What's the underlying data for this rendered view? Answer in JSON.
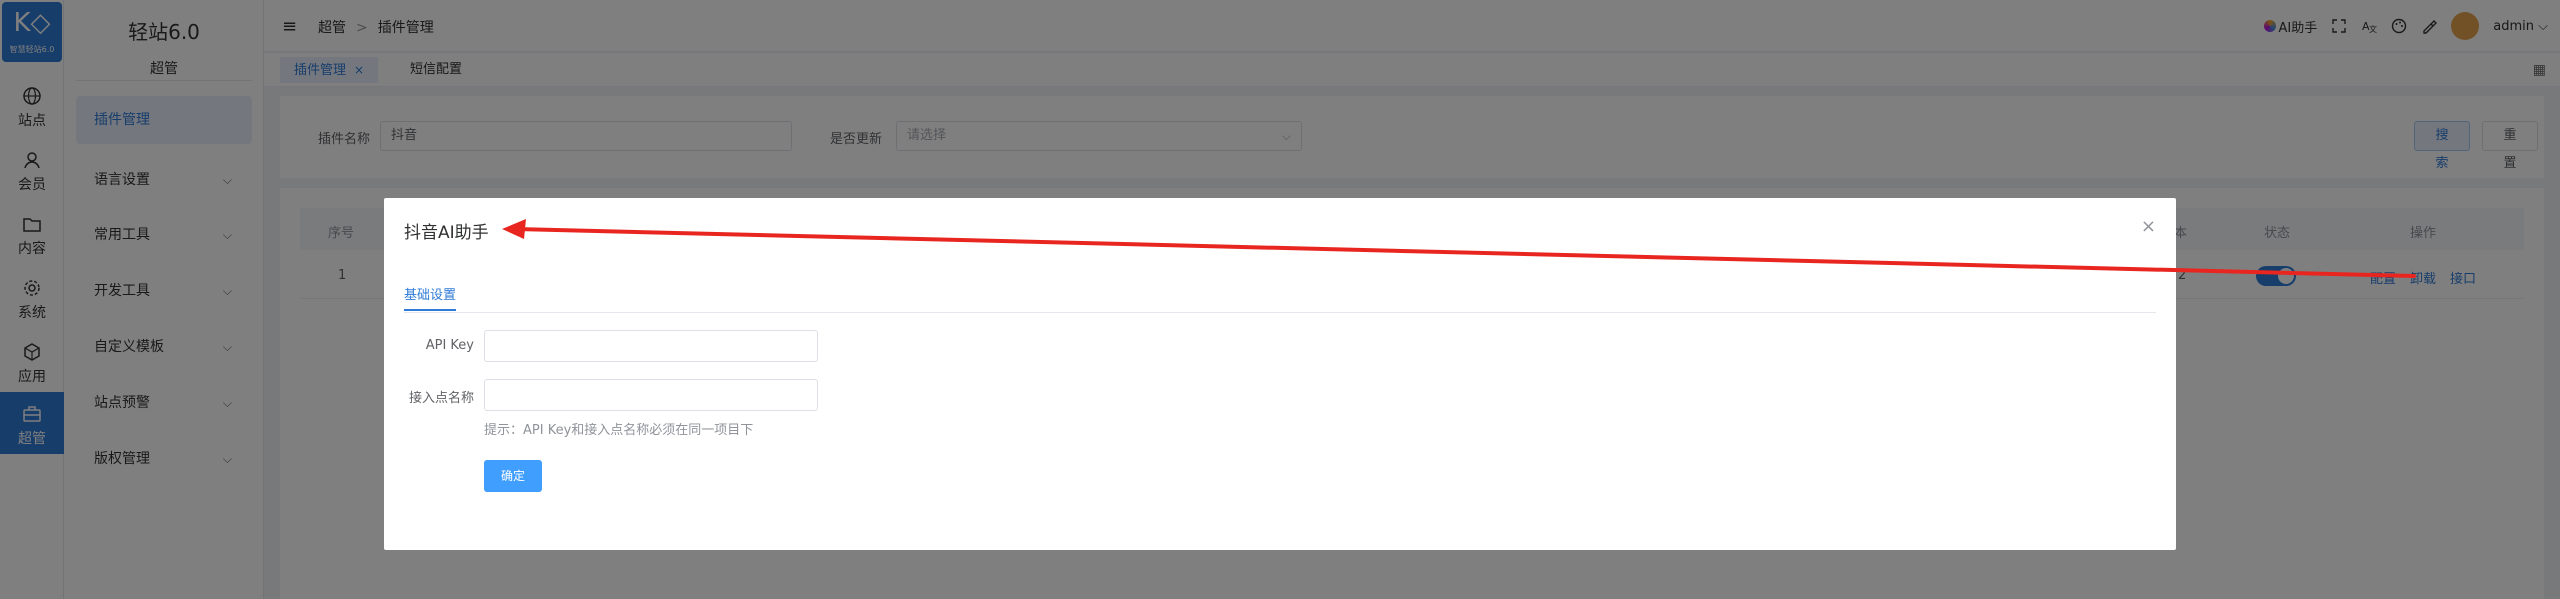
{
  "rail": {
    "logo_mark": "K◇",
    "logo_sub": "智慧轻站6.0",
    "items": [
      {
        "label": "站点",
        "icon": "globe-icon"
      },
      {
        "label": "会员",
        "icon": "user-icon"
      },
      {
        "label": "内容",
        "icon": "folder-icon"
      },
      {
        "label": "系统",
        "icon": "gear-icon"
      },
      {
        "label": "应用",
        "icon": "box-icon"
      },
      {
        "label": "超管",
        "icon": "briefcase-icon"
      }
    ]
  },
  "sidebar": {
    "title": "轻站6.0",
    "subtitle": "超管",
    "items": [
      {
        "label": "插件管理"
      },
      {
        "label": "语言设置"
      },
      {
        "label": "常用工具"
      },
      {
        "label": "开发工具"
      },
      {
        "label": "自定义模板"
      },
      {
        "label": "站点预警"
      },
      {
        "label": "版权管理"
      }
    ]
  },
  "header": {
    "breadcrumb": [
      "超管",
      "插件管理"
    ],
    "breadcrumb_sep": ">",
    "ai_label": "AI助手",
    "user": "admin"
  },
  "tabs": [
    {
      "label": "插件管理",
      "close": "×"
    },
    {
      "label": "短信配置"
    }
  ],
  "search": {
    "name_label": "插件名称",
    "name_value": "抖音",
    "update_label": "是否更新",
    "update_placeholder": "请选择",
    "search_btn": "搜索",
    "reset_btn": "重置"
  },
  "table": {
    "columns": [
      "序号",
      "本",
      "状态",
      "操作"
    ],
    "rows": [
      {
        "index": "1",
        "version": "2",
        "status_on": true,
        "actions": [
          "配置",
          "卸载",
          "接口"
        ]
      }
    ]
  },
  "dialog": {
    "title": "抖音AI助手",
    "close": "×",
    "tab": "基础设置",
    "fields": [
      {
        "label": "API Key",
        "value": ""
      },
      {
        "label": "接入点名称",
        "value": ""
      }
    ],
    "hint": "提示：API Key和接入点名称必须在同一项目下",
    "confirm": "确定"
  },
  "colors": {
    "brand": "#2f7ad6",
    "primary": "#409eff",
    "annotation": "#e8261f"
  }
}
